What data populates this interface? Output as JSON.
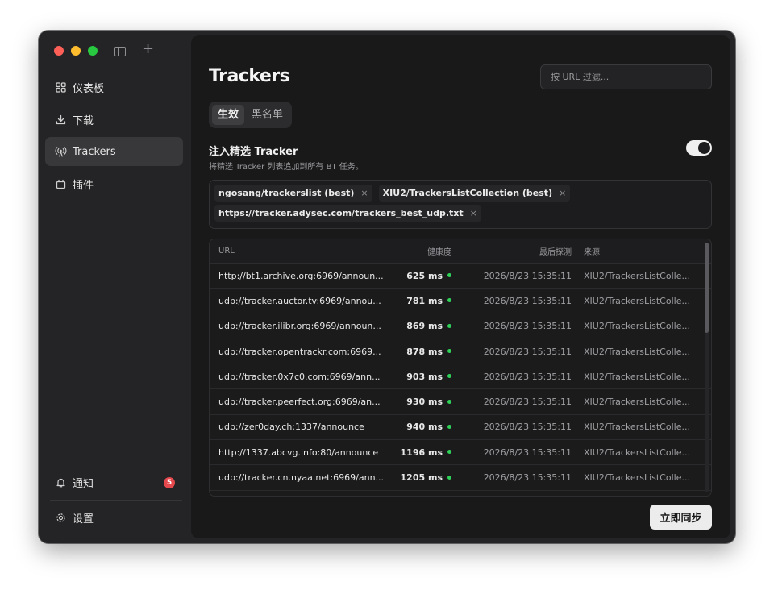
{
  "sidebar": {
    "toolbar": {
      "sidebar_toggle_icon": "sidebar-icon",
      "add_icon": "plus-icon",
      "add_glyph": "+"
    },
    "items": [
      {
        "icon": "dashboard-icon",
        "label": "仪表板"
      },
      {
        "icon": "download-icon",
        "label": "下载"
      },
      {
        "icon": "antenna-icon",
        "label": "Trackers",
        "active": true
      },
      {
        "icon": "plugin-icon",
        "label": "插件"
      }
    ],
    "footer": [
      {
        "icon": "bell-icon",
        "label": "通知",
        "badge": "5"
      },
      {
        "icon": "gear-icon",
        "label": "设置"
      }
    ]
  },
  "main": {
    "title": "Trackers",
    "search": {
      "placeholder": "按 URL 过滤..."
    },
    "tabs": [
      {
        "label": "生效",
        "active": true
      },
      {
        "label": "黑名单",
        "active": false
      }
    ],
    "inject": {
      "title": "注入精选 Tracker",
      "description": "将精选 Tracker 列表追加到所有 BT 任务。",
      "enabled": true
    },
    "lists": [
      "ngosang/trackerslist (best)",
      "XIU2/TrackersListCollection (best)",
      "https://tracker.adysec.com/trackers_best_udp.txt"
    ],
    "chip_close": "×",
    "table": {
      "columns": {
        "url": "URL",
        "health": "健康度",
        "last_probe": "最后探测",
        "source": "来源"
      },
      "rows": [
        {
          "url": "http://bt1.archive.org:6969/announ...",
          "health": "625 ms",
          "last": "2026/8/23 15:35:11",
          "source": "XIU2/TrackersListColle..."
        },
        {
          "url": "udp://tracker.auctor.tv:6969/annou...",
          "health": "781 ms",
          "last": "2026/8/23 15:35:11",
          "source": "XIU2/TrackersListColle..."
        },
        {
          "url": "udp://tracker.ilibr.org:6969/announ...",
          "health": "869 ms",
          "last": "2026/8/23 15:35:11",
          "source": "XIU2/TrackersListColle..."
        },
        {
          "url": "udp://tracker.opentrackr.com:6969...",
          "health": "878 ms",
          "last": "2026/8/23 15:35:11",
          "source": "XIU2/TrackersListColle..."
        },
        {
          "url": "udp://tracker.0x7c0.com:6969/ann...",
          "health": "903 ms",
          "last": "2026/8/23 15:35:11",
          "source": "XIU2/TrackersListColle..."
        },
        {
          "url": "udp://tracker.peerfect.org:6969/an...",
          "health": "930 ms",
          "last": "2026/8/23 15:35:11",
          "source": "XIU2/TrackersListColle..."
        },
        {
          "url": "udp://zer0day.ch:1337/announce",
          "health": "940 ms",
          "last": "2026/8/23 15:35:11",
          "source": "XIU2/TrackersListColle..."
        },
        {
          "url": "http://1337.abcvg.info:80/announce",
          "health": "1196 ms",
          "last": "2026/8/23 15:35:11",
          "source": "XIU2/TrackersListColle..."
        },
        {
          "url": "udp://tracker.cn.nyaa.net:6969/ann...",
          "health": "1205 ms",
          "last": "2026/8/23 15:35:11",
          "source": "XIU2/TrackersListColle..."
        }
      ]
    },
    "sync_button": "立即同步"
  },
  "colors": {
    "accent_green": "#30d158",
    "badge_red": "#e5484d",
    "sidebar_active": "#38383b"
  }
}
